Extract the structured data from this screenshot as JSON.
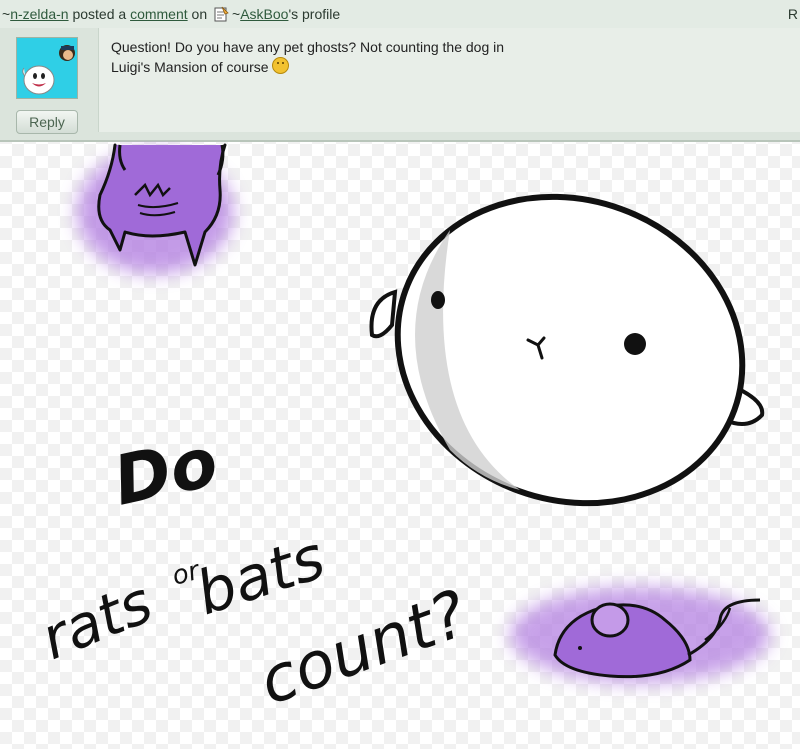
{
  "header": {
    "tilde1": "~",
    "commenter": "n-zelda-n",
    "posted": " posted a ",
    "comment_link": "comment",
    "on": " on ",
    "tilde2": "~",
    "profile_owner": "AskBoo",
    "profile_suffix": "'s profile",
    "edge_char": "R"
  },
  "comment": {
    "line1": "Question! Do you have any pet ghosts? Not counting the dog in",
    "line2": "Luigi's Mansion of course",
    "reply_label": "Reply"
  },
  "drawing": {
    "word_do": "Do",
    "word_rats": "rats",
    "word_or": "or",
    "word_bats": "bats",
    "word_count": "count?"
  },
  "colors": {
    "avatar_bg": "#2fcfe6",
    "purple_glow": "#b07ae0",
    "purple_ink": "#4b2a8a",
    "ink": "#111111",
    "link": "#2f5a3d"
  },
  "icons": [
    "note-icon",
    "smiley-icon",
    "boo-ghost-icon"
  ]
}
